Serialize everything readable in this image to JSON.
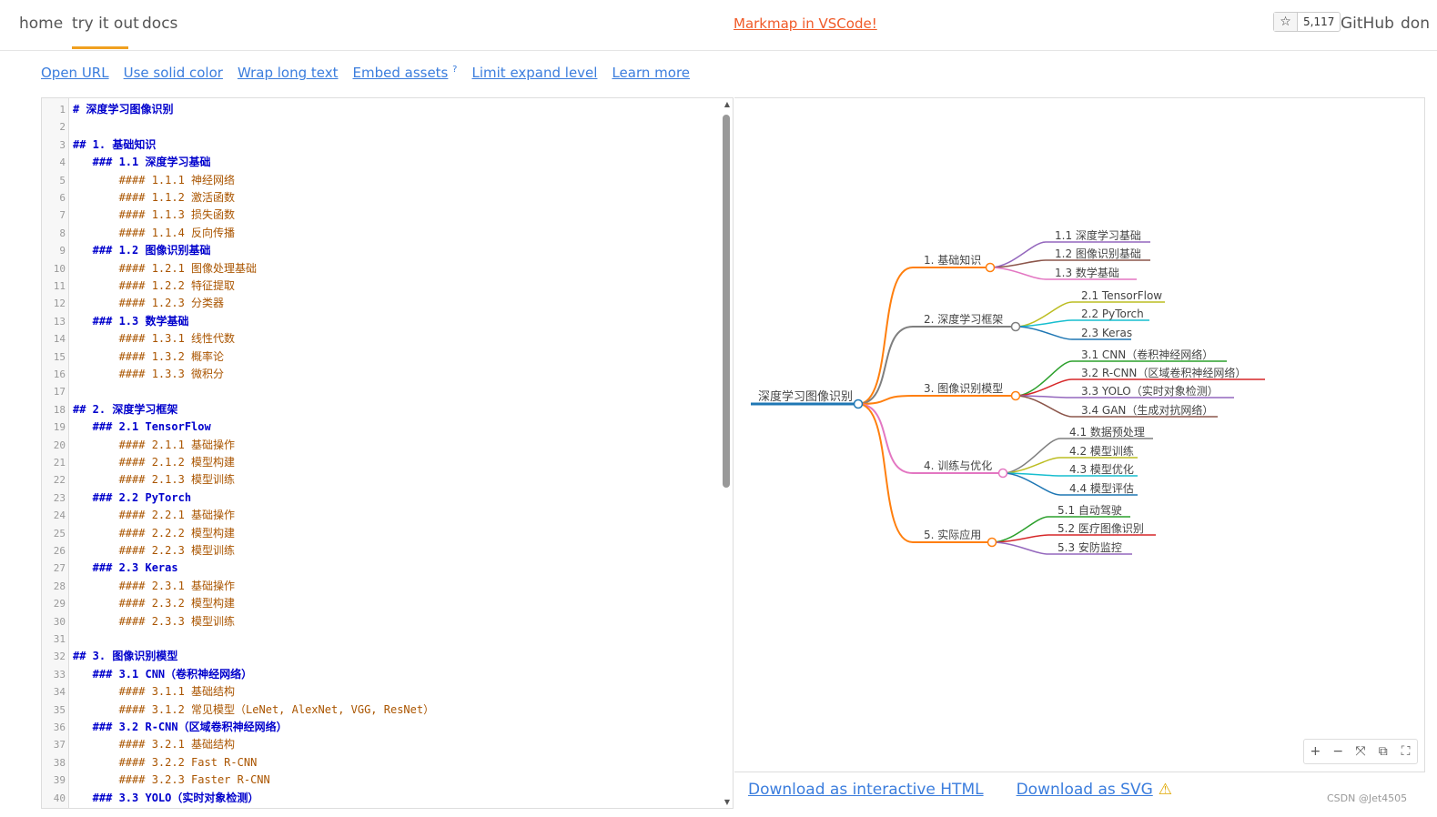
{
  "nav": {
    "home": "home",
    "try": "try it out",
    "docs": "docs",
    "promo": "Markmap in VSCode!",
    "star_count": "5,117",
    "github": "GitHub",
    "donate": "don"
  },
  "toolbar": {
    "open_url": "Open URL",
    "solid_color": "Use solid color",
    "wrap_text": "Wrap long text",
    "embed_assets": "Embed assets",
    "embed_sup": "?",
    "limit_expand": "Limit expand level",
    "learn_more": "Learn more"
  },
  "editor": {
    "lines": [
      {
        "n": "1",
        "t": "# 深度学习图像识别",
        "k": "h1"
      },
      {
        "n": "2",
        "t": "",
        "k": ""
      },
      {
        "n": "3",
        "t": "## 1. 基础知识",
        "k": "h2"
      },
      {
        "n": "4",
        "t": "   ### 1.1 深度学习基础",
        "k": "h3"
      },
      {
        "n": "5",
        "t": "       #### 1.1.1 神经网络",
        "k": "h4"
      },
      {
        "n": "6",
        "t": "       #### 1.1.2 激活函数",
        "k": "h4"
      },
      {
        "n": "7",
        "t": "       #### 1.1.3 损失函数",
        "k": "h4"
      },
      {
        "n": "8",
        "t": "       #### 1.1.4 反向传播",
        "k": "h4"
      },
      {
        "n": "9",
        "t": "   ### 1.2 图像识别基础",
        "k": "h3"
      },
      {
        "n": "10",
        "t": "       #### 1.2.1 图像处理基础",
        "k": "h4"
      },
      {
        "n": "11",
        "t": "       #### 1.2.2 特征提取",
        "k": "h4"
      },
      {
        "n": "12",
        "t": "       #### 1.2.3 分类器",
        "k": "h4"
      },
      {
        "n": "13",
        "t": "   ### 1.3 数学基础",
        "k": "h3"
      },
      {
        "n": "14",
        "t": "       #### 1.3.1 线性代数",
        "k": "h4"
      },
      {
        "n": "15",
        "t": "       #### 1.3.2 概率论",
        "k": "h4"
      },
      {
        "n": "16",
        "t": "       #### 1.3.3 微积分",
        "k": "h4"
      },
      {
        "n": "17",
        "t": "",
        "k": ""
      },
      {
        "n": "18",
        "t": "## 2. 深度学习框架",
        "k": "h2"
      },
      {
        "n": "19",
        "t": "   ### 2.1 TensorFlow",
        "k": "h3"
      },
      {
        "n": "20",
        "t": "       #### 2.1.1 基础操作",
        "k": "h4"
      },
      {
        "n": "21",
        "t": "       #### 2.1.2 模型构建",
        "k": "h4"
      },
      {
        "n": "22",
        "t": "       #### 2.1.3 模型训练",
        "k": "h4"
      },
      {
        "n": "23",
        "t": "   ### 2.2 PyTorch",
        "k": "h3"
      },
      {
        "n": "24",
        "t": "       #### 2.2.1 基础操作",
        "k": "h4"
      },
      {
        "n": "25",
        "t": "       #### 2.2.2 模型构建",
        "k": "h4"
      },
      {
        "n": "26",
        "t": "       #### 2.2.3 模型训练",
        "k": "h4"
      },
      {
        "n": "27",
        "t": "   ### 2.3 Keras",
        "k": "h3"
      },
      {
        "n": "28",
        "t": "       #### 2.3.1 基础操作",
        "k": "h4"
      },
      {
        "n": "29",
        "t": "       #### 2.3.2 模型构建",
        "k": "h4"
      },
      {
        "n": "30",
        "t": "       #### 2.3.3 模型训练",
        "k": "h4"
      },
      {
        "n": "31",
        "t": "",
        "k": ""
      },
      {
        "n": "32",
        "t": "## 3. 图像识别模型",
        "k": "h2"
      },
      {
        "n": "33",
        "t": "   ### 3.1 CNN（卷积神经网络）",
        "k": "h3"
      },
      {
        "n": "34",
        "t": "       #### 3.1.1 基础结构",
        "k": "h4"
      },
      {
        "n": "35",
        "t": "       #### 3.1.2 常见模型（LeNet, AlexNet, VGG, ResNet）",
        "k": "h4"
      },
      {
        "n": "36",
        "t": "   ### 3.2 R-CNN（区域卷积神经网络）",
        "k": "h3"
      },
      {
        "n": "37",
        "t": "       #### 3.2.1 基础结构",
        "k": "h4"
      },
      {
        "n": "38",
        "t": "       #### 3.2.2 Fast R-CNN",
        "k": "h4"
      },
      {
        "n": "39",
        "t": "       #### 3.2.3 Faster R-CNN",
        "k": "h4"
      },
      {
        "n": "40",
        "t": "   ### 3.3 YOLO（实时对象检测）",
        "k": "h3"
      }
    ]
  },
  "mindmap": {
    "root": "深度学习图像识别",
    "branches": [
      {
        "label": "1. 基础知识",
        "color": "#ff7f0e",
        "children": [
          {
            "label": "1.1 深度学习基础",
            "color": "#9467bd"
          },
          {
            "label": "1.2 图像识别基础",
            "color": "#8c564b"
          },
          {
            "label": "1.3 数学基础",
            "color": "#e377c2"
          }
        ]
      },
      {
        "label": "2. 深度学习框架",
        "color": "#7f7f7f",
        "children": [
          {
            "label": "2.1 TensorFlow",
            "color": "#bcbd22"
          },
          {
            "label": "2.2 PyTorch",
            "color": "#17becf"
          },
          {
            "label": "2.3 Keras",
            "color": "#1f77b4"
          }
        ]
      },
      {
        "label": "3. 图像识别模型",
        "color": "#ff7f0e",
        "children": [
          {
            "label": "3.1 CNN（卷积神经网络）",
            "color": "#2ca02c"
          },
          {
            "label": "3.2 R-CNN（区域卷积神经网络）",
            "color": "#d62728"
          },
          {
            "label": "3.3 YOLO（实时对象检测）",
            "color": "#9467bd"
          },
          {
            "label": "3.4 GAN（生成对抗网络）",
            "color": "#8c564b"
          }
        ]
      },
      {
        "label": "4. 训练与优化",
        "color": "#e377c2",
        "children": [
          {
            "label": "4.1 数据预处理",
            "color": "#7f7f7f"
          },
          {
            "label": "4.2 模型训练",
            "color": "#bcbd22"
          },
          {
            "label": "4.3 模型优化",
            "color": "#17becf"
          },
          {
            "label": "4.4 模型评估",
            "color": "#1f77b4"
          }
        ]
      },
      {
        "label": "5. 实际应用",
        "color": "#ff7f0e",
        "children": [
          {
            "label": "5.1 自动驾驶",
            "color": "#2ca02c"
          },
          {
            "label": "5.2 医疗图像识别",
            "color": "#d62728"
          },
          {
            "label": "5.3 安防监控",
            "color": "#9467bd"
          }
        ]
      }
    ],
    "root_color": "#1f77b4"
  },
  "mm_toolbar": {
    "zoom_in": "+",
    "zoom_out": "−",
    "fit": "⤧",
    "toggle": "⧉",
    "fullscreen": "⛶"
  },
  "downloads": {
    "html": "Download as interactive HTML",
    "svg": "Download as SVG",
    "warn": "⚠"
  },
  "watermark": "CSDN @Jet4505"
}
